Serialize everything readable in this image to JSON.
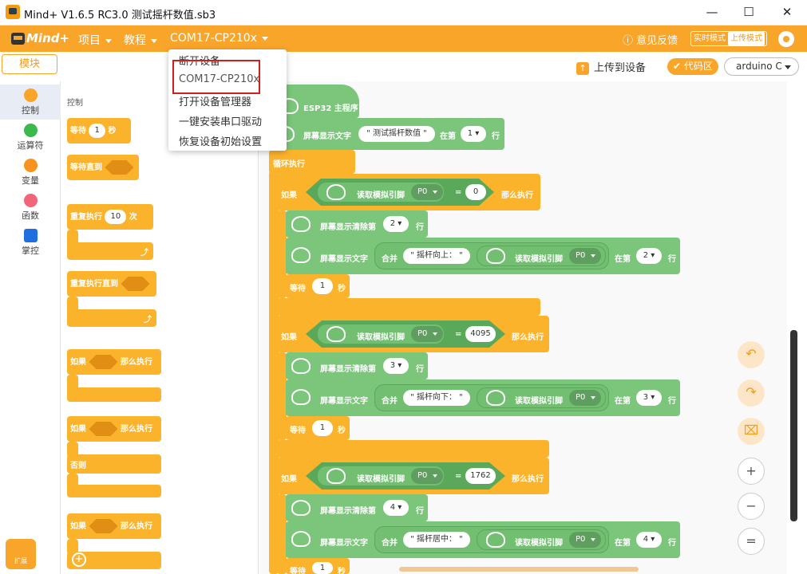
{
  "window": {
    "title": "Mind+ V1.6.5 RC3.0   测试摇杆数值.sb3",
    "minimize": "—",
    "maximize": "☐",
    "close": "✕"
  },
  "menubar": {
    "logo": "Mind+",
    "items": [
      "项目",
      "教程",
      "COM17-CP210x"
    ],
    "feedback": "意见反馈",
    "mode_realtime": "实时模式",
    "mode_upload": "上传模式"
  },
  "dropdown": {
    "items": [
      "断开设备",
      "COM17-CP210x",
      "打开设备管理器",
      "一键安装串口驱动",
      "恢复设备初始设置"
    ]
  },
  "toolbar": {
    "module_tab": "模块",
    "upload": "上传到设备",
    "code_area": "代码区",
    "board": "arduino C"
  },
  "categories": [
    {
      "label": "控制",
      "color": "#f8a52a"
    },
    {
      "label": "运算符",
      "color": "#3cb94c"
    },
    {
      "label": "变量",
      "color": "#f7931e"
    },
    {
      "label": "函数",
      "color": "#f2647a"
    },
    {
      "label": "掌控",
      "color": "#1f6fe0"
    }
  ],
  "palette": {
    "title": "控制",
    "wait_label": "等待",
    "wait_value": "1",
    "wait_unit": "秒",
    "wait_until": "等待直到",
    "repeat_label": "重复执行",
    "repeat_value": "10",
    "repeat_unit": "次",
    "repeat_until": "重复执行直到",
    "if_label": "如果",
    "then_label": "那么执行",
    "else_label": "否则",
    "extend": "扩展"
  },
  "script": {
    "hat": "ESP32 主程序",
    "display_text": "屏幕显示文字",
    "title_value": "测试摇杆数值",
    "at_line": "在第",
    "row": "行",
    "loop": "循环执行",
    "if": "如果",
    "then": "那么执行",
    "read_analog": "读取模拟引脚",
    "pin": "P0",
    "eq": "=",
    "clear_line": "屏幕显示清除第",
    "join": "合并",
    "wait": "等待",
    "wait_val": "1",
    "sec": "秒",
    "cases": [
      {
        "value": "0",
        "line": "2",
        "text": "摇杆向上："
      },
      {
        "value": "4095",
        "line": "3",
        "text": "摇杆向下："
      },
      {
        "value": "1762",
        "line": "4",
        "text": "摇杆居中："
      }
    ],
    "first_line": "1"
  },
  "zoom": {
    "undo": "↶",
    "redo": "↷",
    "clean": "⌧",
    "zoom_in": "+",
    "zoom_out": "−",
    "reset": "="
  }
}
